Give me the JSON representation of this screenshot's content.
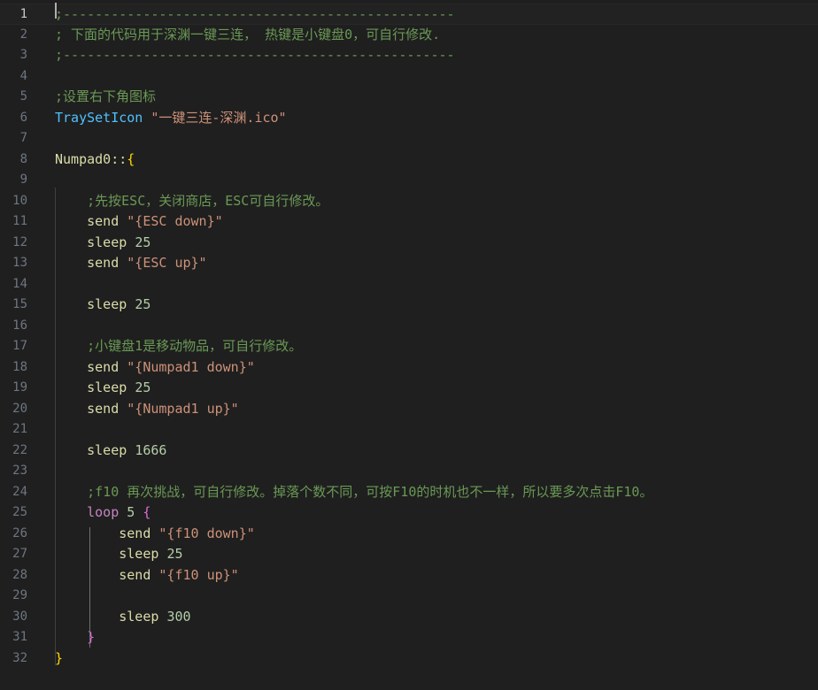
{
  "editor": {
    "lines": [
      {
        "num": "1",
        "active": true,
        "tokens": [
          {
            "t": ";-------------------------------------------------",
            "c": "comment"
          }
        ]
      },
      {
        "num": "2",
        "tokens": [
          {
            "t": "; 下面的代码用于深渊一键三连， 热键是小键盘0，可自行修改.",
            "c": "comment"
          }
        ]
      },
      {
        "num": "3",
        "tokens": [
          {
            "t": ";-------------------------------------------------",
            "c": "comment"
          }
        ]
      },
      {
        "num": "4",
        "tokens": []
      },
      {
        "num": "5",
        "tokens": [
          {
            "t": ";设置右下角图标",
            "c": "comment"
          }
        ]
      },
      {
        "num": "6",
        "tokens": [
          {
            "t": "TraySetIcon",
            "c": "func"
          },
          {
            "t": " ",
            "c": "plain"
          },
          {
            "t": "\"一键三连-深渊.ico\"",
            "c": "str"
          }
        ]
      },
      {
        "num": "7",
        "tokens": []
      },
      {
        "num": "8",
        "tokens": [
          {
            "t": "Numpad0::",
            "c": "ident"
          },
          {
            "t": "{",
            "c": "brace1"
          }
        ]
      },
      {
        "num": "9",
        "tokens": []
      },
      {
        "num": "10",
        "tokens": [
          {
            "t": "    ",
            "c": "plain"
          },
          {
            "t": ";先按ESC，关闭商店，ESC可自行修改。",
            "c": "comment"
          }
        ]
      },
      {
        "num": "11",
        "tokens": [
          {
            "t": "    send ",
            "c": "ident"
          },
          {
            "t": "\"{ESC down}\"",
            "c": "str"
          }
        ]
      },
      {
        "num": "12",
        "tokens": [
          {
            "t": "    sleep ",
            "c": "ident"
          },
          {
            "t": "25",
            "c": "num"
          }
        ]
      },
      {
        "num": "13",
        "tokens": [
          {
            "t": "    send ",
            "c": "ident"
          },
          {
            "t": "\"{ESC up}\"",
            "c": "str"
          }
        ]
      },
      {
        "num": "14",
        "tokens": []
      },
      {
        "num": "15",
        "tokens": [
          {
            "t": "    sleep ",
            "c": "ident"
          },
          {
            "t": "25",
            "c": "num"
          }
        ]
      },
      {
        "num": "16",
        "tokens": []
      },
      {
        "num": "17",
        "tokens": [
          {
            "t": "    ",
            "c": "plain"
          },
          {
            "t": ";小键盘1是移动物品，可自行修改。",
            "c": "comment"
          }
        ]
      },
      {
        "num": "18",
        "tokens": [
          {
            "t": "    send ",
            "c": "ident"
          },
          {
            "t": "\"{Numpad1 down}\"",
            "c": "str"
          }
        ]
      },
      {
        "num": "19",
        "tokens": [
          {
            "t": "    sleep ",
            "c": "ident"
          },
          {
            "t": "25",
            "c": "num"
          }
        ]
      },
      {
        "num": "20",
        "tokens": [
          {
            "t": "    send ",
            "c": "ident"
          },
          {
            "t": "\"{Numpad1 up}\"",
            "c": "str"
          }
        ]
      },
      {
        "num": "21",
        "tokens": []
      },
      {
        "num": "22",
        "tokens": [
          {
            "t": "    sleep ",
            "c": "ident"
          },
          {
            "t": "1666",
            "c": "num"
          }
        ]
      },
      {
        "num": "23",
        "tokens": []
      },
      {
        "num": "24",
        "tokens": [
          {
            "t": "    ",
            "c": "plain"
          },
          {
            "t": ";f10 再次挑战，可自行修改。掉落个数不同，可按F10的时机也不一样，所以要多次点击F10。",
            "c": "comment"
          }
        ]
      },
      {
        "num": "25",
        "tokens": [
          {
            "t": "    ",
            "c": "plain"
          },
          {
            "t": "loop",
            "c": "kw"
          },
          {
            "t": " ",
            "c": "plain"
          },
          {
            "t": "5",
            "c": "num"
          },
          {
            "t": " ",
            "c": "plain"
          },
          {
            "t": "{",
            "c": "brace2"
          }
        ]
      },
      {
        "num": "26",
        "tokens": [
          {
            "t": "        send ",
            "c": "ident"
          },
          {
            "t": "\"{f10 down}\"",
            "c": "str"
          }
        ]
      },
      {
        "num": "27",
        "tokens": [
          {
            "t": "        sleep ",
            "c": "ident"
          },
          {
            "t": "25",
            "c": "num"
          }
        ]
      },
      {
        "num": "28",
        "tokens": [
          {
            "t": "        send ",
            "c": "ident"
          },
          {
            "t": "\"{f10 up}\"",
            "c": "str"
          }
        ]
      },
      {
        "num": "29",
        "tokens": []
      },
      {
        "num": "30",
        "tokens": [
          {
            "t": "        sleep ",
            "c": "ident"
          },
          {
            "t": "300",
            "c": "num"
          }
        ]
      },
      {
        "num": "31",
        "tokens": [
          {
            "t": "    ",
            "c": "plain"
          },
          {
            "t": "}",
            "c": "brace2"
          }
        ]
      },
      {
        "num": "32",
        "tokens": [
          {
            "t": "}",
            "c": "brace1"
          }
        ]
      }
    ]
  }
}
